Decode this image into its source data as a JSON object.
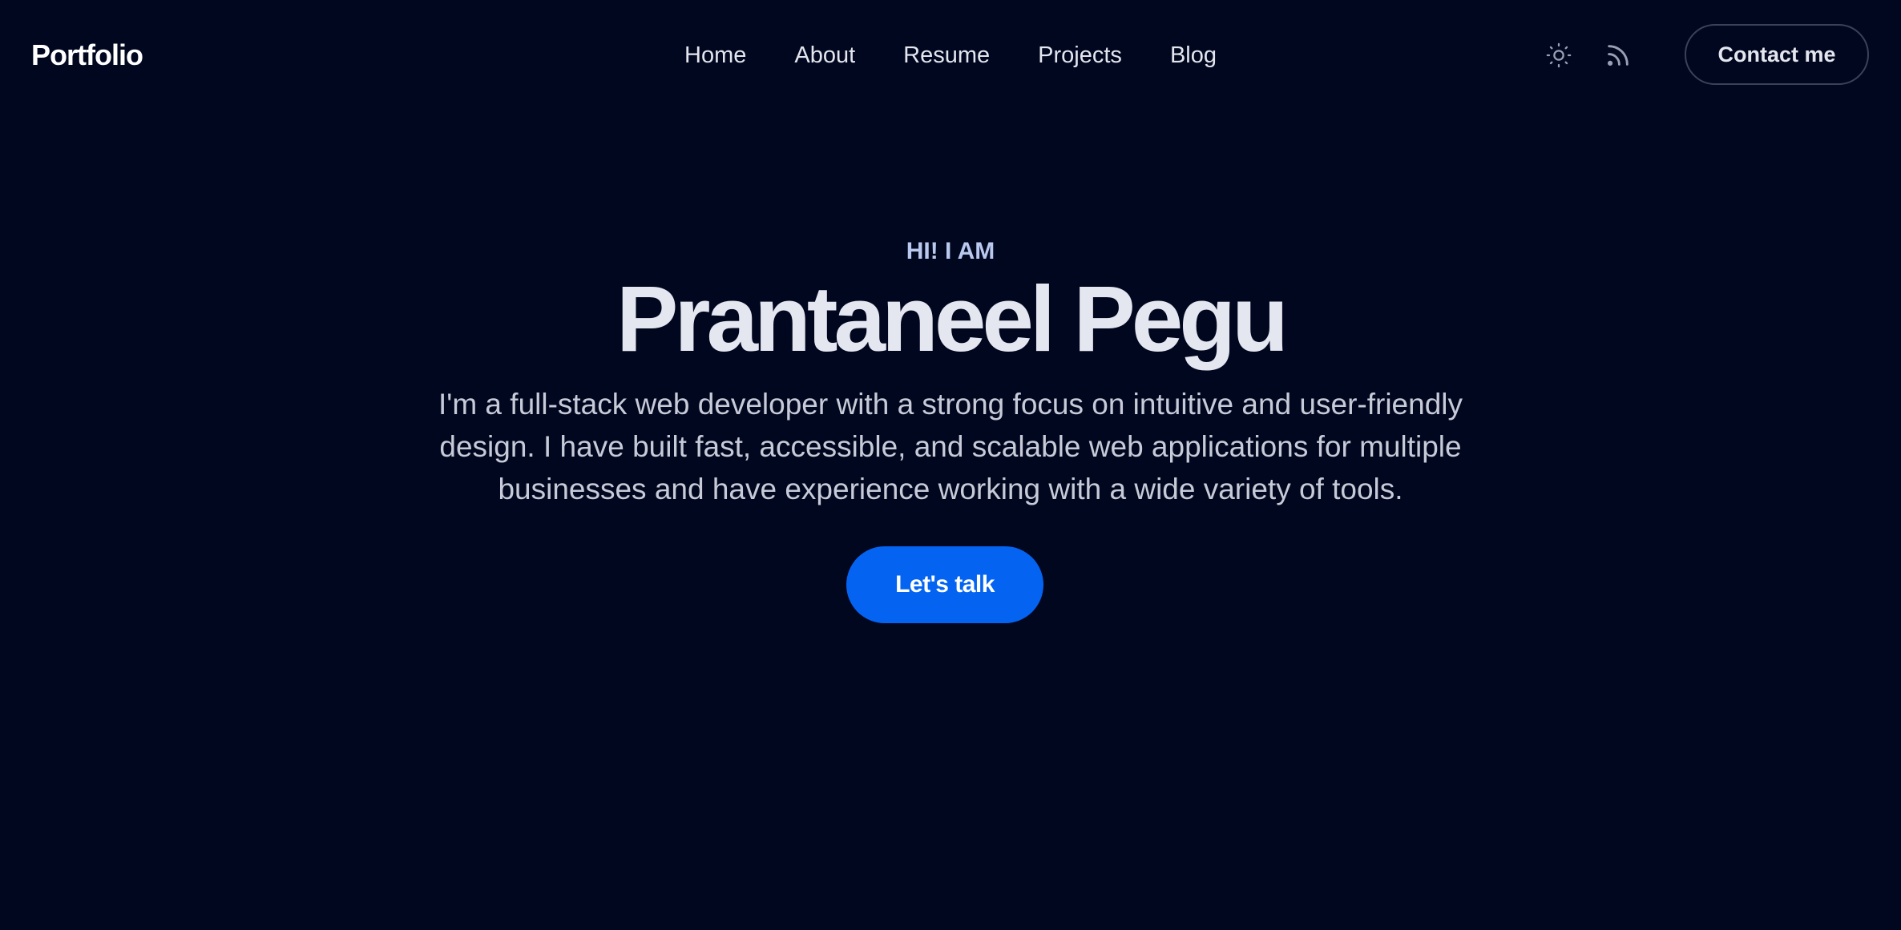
{
  "header": {
    "logo": "Portfolio",
    "nav": [
      {
        "label": "Home"
      },
      {
        "label": "About"
      },
      {
        "label": "Resume"
      },
      {
        "label": "Projects"
      },
      {
        "label": "Blog"
      }
    ],
    "icons": {
      "theme_toggle": "sun-icon",
      "rss": "rss-icon"
    },
    "contact_label": "Contact me"
  },
  "hero": {
    "eyebrow": "HI! I AM",
    "name": "Prantaneel Pegu",
    "description": "I'm a full-stack web developer with a strong focus on intuitive and user-friendly design. I have built fast, accessible, and scalable web applications for multiple businesses and have experience working with a wide variety of tools.",
    "cta_label": "Let's talk"
  },
  "colors": {
    "background": "#020720",
    "accent": "#0464f1",
    "eyebrow": "#b9c8ee",
    "text": "#e4e6f0"
  }
}
